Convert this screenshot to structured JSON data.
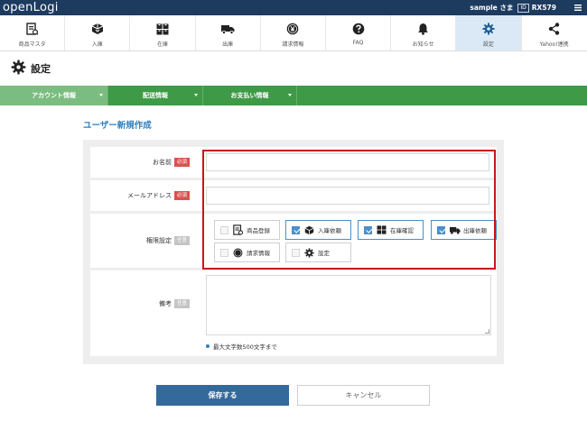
{
  "app": {
    "logo_text": "openLogi",
    "user_name": "sample さま",
    "id_label": "ID",
    "user_id": "RX579"
  },
  "nav": {
    "items": [
      {
        "label": "商品マスタ",
        "icon": "product-master-icon"
      },
      {
        "label": "入庫",
        "icon": "inbound-icon"
      },
      {
        "label": "在庫",
        "icon": "inventory-icon"
      },
      {
        "label": "出庫",
        "icon": "outbound-truck-icon"
      },
      {
        "label": "請求情報",
        "icon": "billing-icon"
      },
      {
        "label": "FAQ",
        "icon": "help-icon"
      },
      {
        "label": "お知らせ",
        "icon": "bell-icon"
      },
      {
        "label": "設定",
        "icon": "gear-icon",
        "active": true
      },
      {
        "label": "Yahoo!連携",
        "icon": "share-icon"
      }
    ]
  },
  "page": {
    "title": "設定"
  },
  "tabs": [
    {
      "label": "アカウント情報",
      "active": true
    },
    {
      "label": "配送情報"
    },
    {
      "label": "お支払い情報"
    }
  ],
  "form": {
    "heading": "ユーザー新規作成",
    "name": {
      "label": "お名前",
      "badge": "必須",
      "value": ""
    },
    "email": {
      "label": "メールアドレス",
      "badge": "必須",
      "value": ""
    },
    "permissions": {
      "label": "権限設定",
      "badge": "任意",
      "options": [
        {
          "label": "商品登録",
          "checked": false,
          "icon": "product-register-icon"
        },
        {
          "label": "入庫依頼",
          "checked": true,
          "icon": "inbound-icon"
        },
        {
          "label": "在庫確認",
          "checked": true,
          "icon": "inventory-icon"
        },
        {
          "label": "出庫依頼",
          "checked": true,
          "icon": "outbound-truck-icon"
        },
        {
          "label": "請求情報",
          "checked": false,
          "icon": "billing-icon"
        },
        {
          "label": "設定",
          "checked": false,
          "icon": "gear-icon"
        }
      ]
    },
    "remarks": {
      "label": "備考",
      "badge": "任意",
      "value": "",
      "note": "最大文字数500文字まで"
    }
  },
  "buttons": {
    "save": "保存する",
    "cancel": "キャンセル"
  },
  "colors": {
    "header_bg": "#1d3a5f",
    "tab_bg": "#3f9a47",
    "accent_blue": "#2f7fbf",
    "required_red": "#d9534f",
    "save_button": "#34699c",
    "highlight_red": "#c8161d"
  }
}
